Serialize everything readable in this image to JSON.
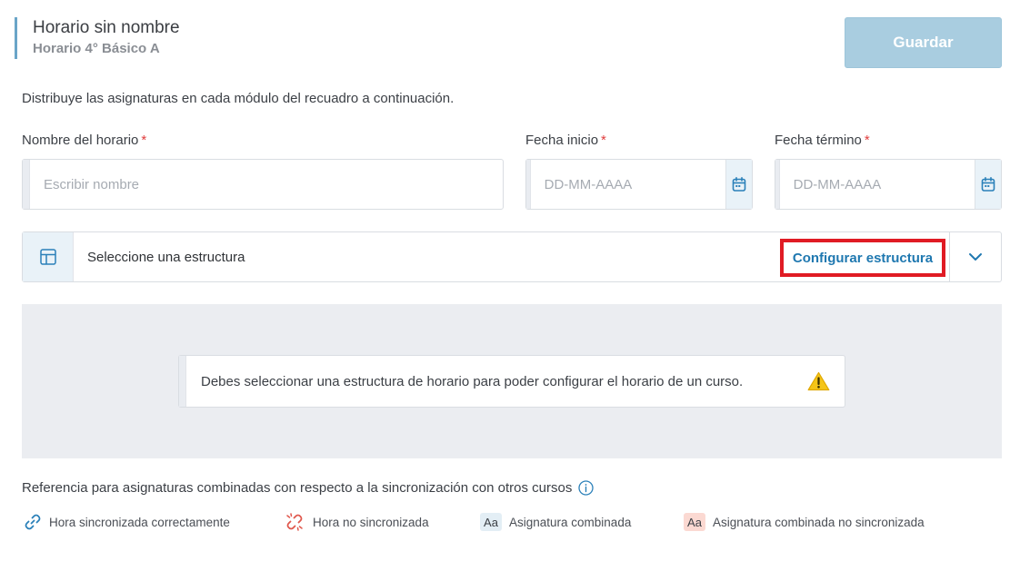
{
  "header": {
    "title": "Horario sin nombre",
    "subtitle": "Horario 4° Básico A",
    "save_label": "Guardar"
  },
  "instructions": "Distribuye las asignaturas en cada módulo del recuadro a continuación.",
  "form": {
    "name": {
      "label": "Nombre del horario",
      "required_mark": "*",
      "placeholder": "Escribir nombre",
      "value": ""
    },
    "start_date": {
      "label": "Fecha inicio",
      "required_mark": "*",
      "placeholder": "DD-MM-AAAA",
      "value": "",
      "icon": "calendar-icon"
    },
    "end_date": {
      "label": "Fecha término",
      "required_mark": "*",
      "placeholder": "DD-MM-AAAA",
      "value": "",
      "icon": "calendar-icon"
    }
  },
  "structure": {
    "icon": "table-layout-icon",
    "label": "Seleccione una estructura",
    "config_link": "Configurar estructura",
    "expand_icon": "chevron-down-icon"
  },
  "alert": {
    "text": "Debes seleccionar una estructura de horario para poder configurar el horario de un curso.",
    "icon": "warning-icon"
  },
  "reference": {
    "title": "Referencia para asignaturas combinadas con respecto a la sincronización con otros cursos",
    "info_icon": "info-icon",
    "items": [
      {
        "icon": "link-icon",
        "label": "Hora sincronizada correctamente"
      },
      {
        "icon": "broken-link-icon",
        "label": "Hora no sincronizada"
      },
      {
        "badge": "Aa",
        "label": "Asignatura combinada"
      },
      {
        "badge": "Aa",
        "label": "Asignatura combinada no sincronizada"
      }
    ]
  },
  "colors": {
    "accent": "#1f78b0",
    "save_button": "#a9cde0",
    "required": "#e03d3d",
    "highlight_box": "#e01b24",
    "panel_bg": "#ebedf1"
  }
}
